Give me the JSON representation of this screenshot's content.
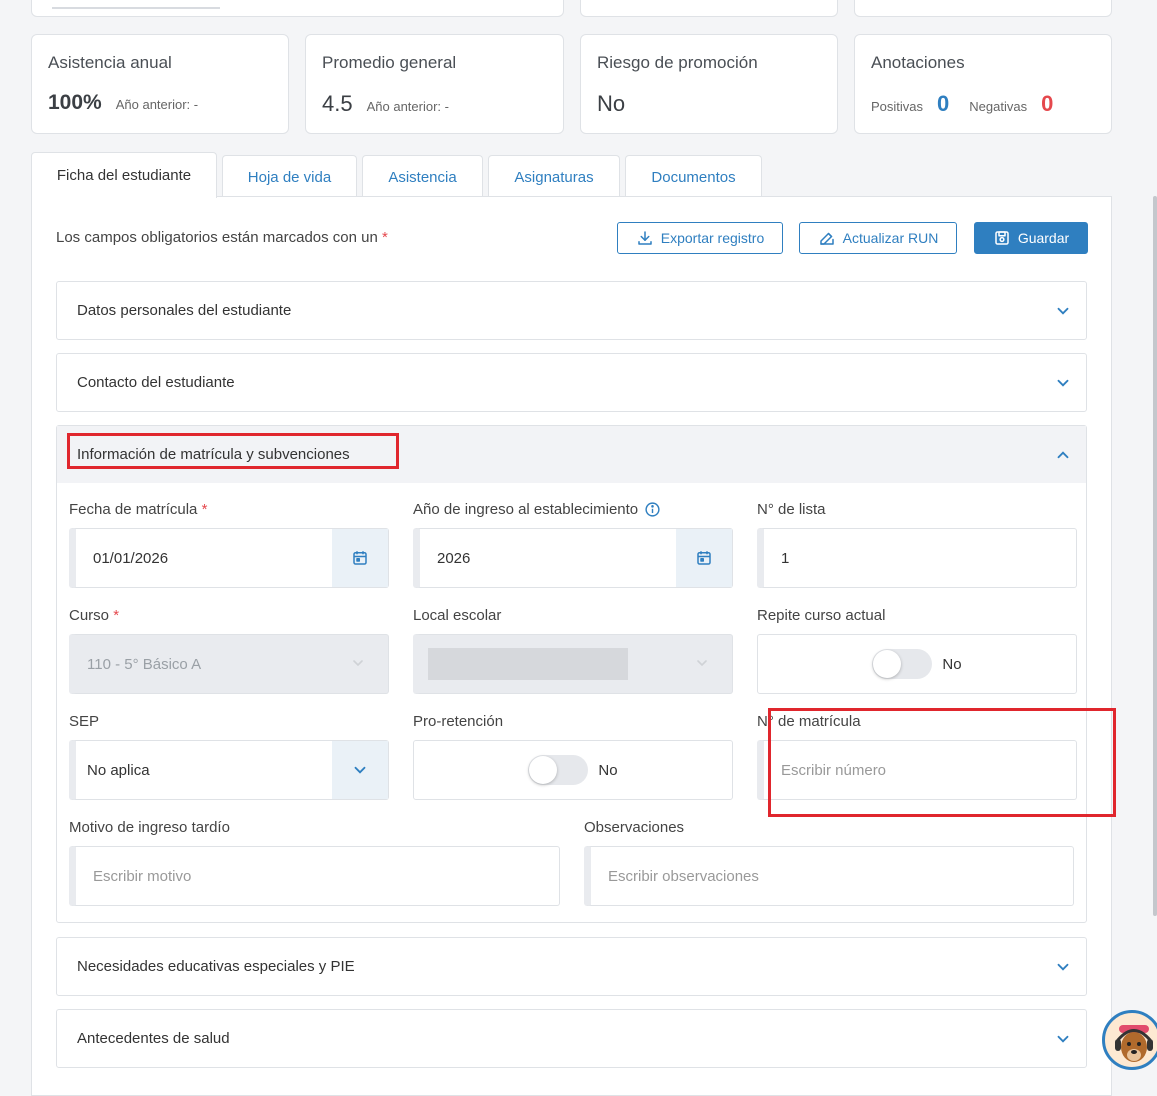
{
  "stats": {
    "asistencia": {
      "label": "Asistencia anual",
      "value": "100%",
      "prev": "Año anterior: -"
    },
    "promedio": {
      "label": "Promedio general",
      "value": "4.5",
      "prev": "Año anterior: -"
    },
    "riesgo": {
      "label": "Riesgo de promoción",
      "value": "No"
    },
    "anotaciones": {
      "label": "Anotaciones",
      "positivas_label": "Positivas",
      "positivas": "0",
      "negativas_label": "Negativas",
      "negativas": "0"
    }
  },
  "tabs": [
    "Ficha del estudiante",
    "Hoja de vida",
    "Asistencia",
    "Asignaturas",
    "Documentos"
  ],
  "toolbar": {
    "required_note": "Los campos obligatorios están marcados con un",
    "required_star": "*",
    "export_label": "Exportar registro",
    "update_run_label": "Actualizar RUN",
    "save_label": "Guardar"
  },
  "sections": {
    "datos_personales": "Datos personales del estudiante",
    "contacto": "Contacto del estudiante",
    "matricula": "Información de matrícula y subvenciones",
    "nee": "Necesidades educativas especiales y PIE",
    "salud": "Antecedentes de salud"
  },
  "form": {
    "fecha_label": "Fecha de matrícula",
    "fecha_value": "01/01/2026",
    "anio_label": "Año de ingreso al establecimiento",
    "anio_value": "2026",
    "lista_label": "N° de lista",
    "lista_value": "1",
    "curso_label": "Curso",
    "curso_value": "110 - 5° Básico A",
    "local_label": "Local escolar",
    "repite_label": "Repite curso actual",
    "repite_value": "No",
    "sep_label": "SEP",
    "sep_value": "No aplica",
    "proret_label": "Pro-retención",
    "proret_value": "No",
    "matricula_label": "N° de matrícula",
    "matricula_placeholder": "Escribir número",
    "motivo_label": "Motivo de ingreso tardío",
    "motivo_placeholder": "Escribir motivo",
    "obs_label": "Observaciones",
    "obs_placeholder": "Escribir observaciones"
  },
  "colors": {
    "accent": "#2f7fc0",
    "danger": "#e5484d",
    "highlight": "#e0262d"
  }
}
